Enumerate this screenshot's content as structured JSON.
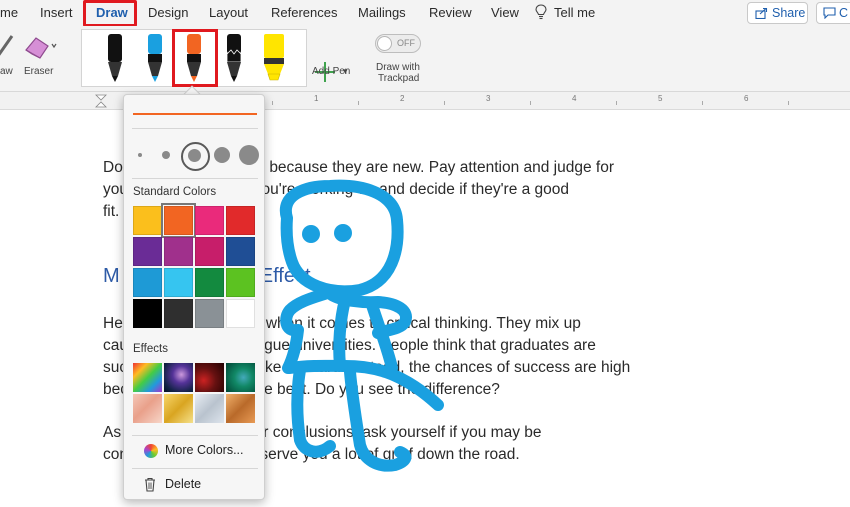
{
  "tabs": [
    "me",
    "Insert",
    "Draw",
    "Design",
    "Layout",
    "References",
    "Mailings",
    "Review",
    "View"
  ],
  "tell_me": "Tell me",
  "share_label": "Share",
  "comment_label": "C",
  "tools": {
    "draw_partial": "aw",
    "eraser": "Eraser",
    "add_pen": "Add Pen",
    "toggle_state": "OFF",
    "trackpad_line1": "Draw with",
    "trackpad_line2": "Trackpad"
  },
  "pens": [
    {
      "name": "black-pen",
      "color": "#111111"
    },
    {
      "name": "blue-pen",
      "color": "#1aa0e0"
    },
    {
      "name": "orange-pen",
      "color": "#f26522"
    },
    {
      "name": "black-pencil",
      "color": "#111111"
    },
    {
      "name": "yellow-highlighter",
      "color": "#ffe500"
    }
  ],
  "ruler": [
    "1",
    "2",
    "3",
    "4",
    "5",
    "6"
  ],
  "panel": {
    "standard_colors_label": "Standard Colors",
    "effects_label": "Effects",
    "more_colors_label": "More Colors...",
    "delete_label": "Delete",
    "selected_color": "#f26522",
    "standard_colors": [
      "#fbbf1c",
      "#f26522",
      "#ea2a7b",
      "#e12a2b",
      "#6a2c96",
      "#a0308c",
      "#c71e6a",
      "#1f4e95",
      "#1e9ad6",
      "#36c5f0",
      "#138a3f",
      "#5cc221",
      "#000000",
      "#2f2f2f",
      "#8a9196",
      "#ffffff"
    ],
    "effects": [
      "rainbow",
      "galaxy",
      "lava",
      "ocean",
      "rose-gold",
      "gold",
      "silver",
      "bronze"
    ]
  },
  "document": {
    "line1": "Do                      r people out of hand because they are new. Pay attention and judge for",
    "line2": "you                    ny issue           problem you're working on and decide if they're a good",
    "line3": "fit.",
    "heading": "M                         ing Cause and Effect",
    "line4": "He                      on mistake peo     ake when it comes to critical thinking. They mix up",
    "line5": "cau                    typic     example     y league universities. People think that graduates are",
    "line6": "suc                    ey went to a schoo    ke Harvard. Instead, the chances of success are high",
    "line7": "bec                   pic     from the best    the best. Do you see the difference?",
    "line8": "As                    your da      an   form your conclusions, ask yourself if you may be",
    "line9": "con                   ffect. It c     d    entially serve you a lot of grief down the road."
  },
  "drawing_color": "#1aa0e0"
}
